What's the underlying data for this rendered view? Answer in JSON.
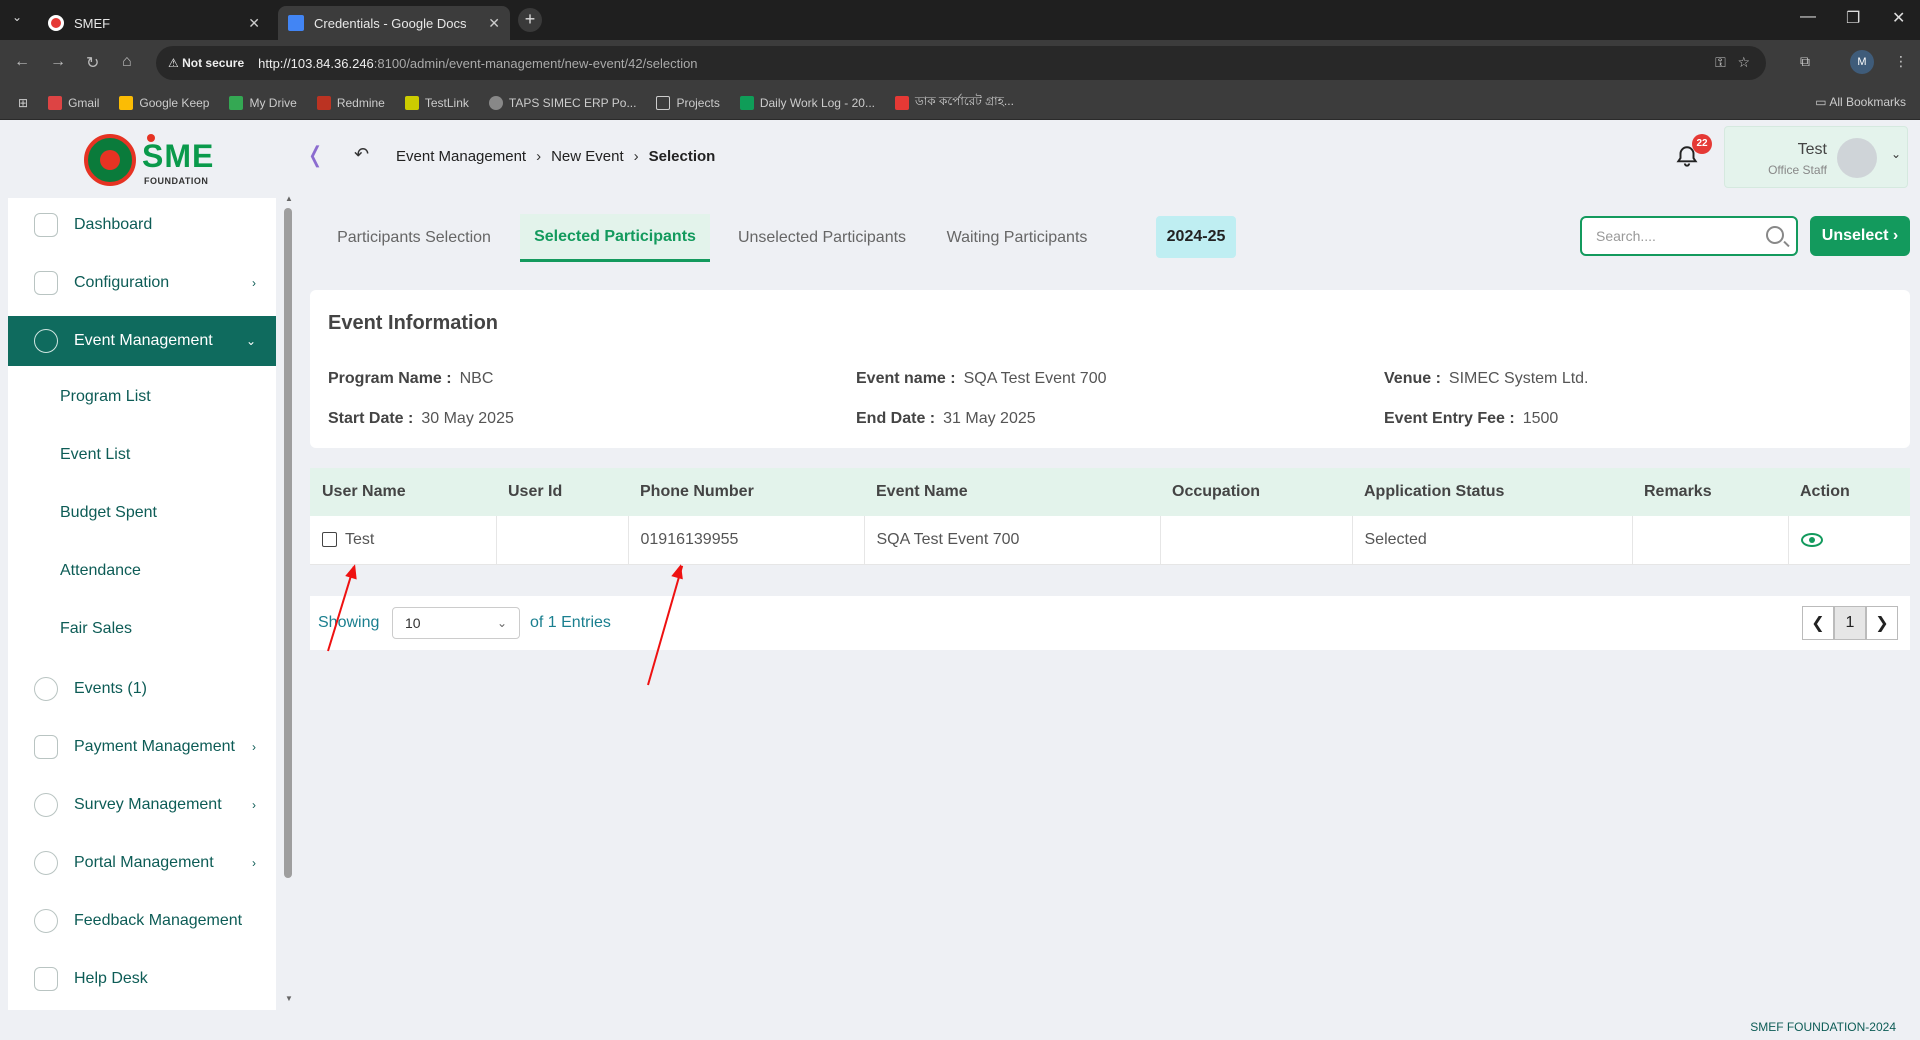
{
  "browser": {
    "tabs": [
      {
        "label": "SMEF"
      },
      {
        "label": "Credentials - Google Docs"
      }
    ],
    "security": "Not secure",
    "url_host": "http://103.84.36.246",
    "url_path": ":8100/admin/event-management/new-event/42/selection",
    "bookmarks": [
      "Gmail",
      "Google Keep",
      "My Drive",
      "Redmine",
      "TestLink",
      "TAPS SIMEC ERP Po...",
      "Projects",
      "Daily Work Log - 20...",
      "ডাক কর্পোরেট গ্রাহ..."
    ],
    "all_bookmarks": "All Bookmarks",
    "profile_initial": "M"
  },
  "header": {
    "logo_text": "SME",
    "logo_sub": "FOUNDATION",
    "breadcrumb": [
      "Event Management",
      "New Event",
      "Selection"
    ],
    "notification_count": "22",
    "user_name": "Test",
    "user_role": "Office Staff"
  },
  "sidebar": {
    "items": [
      {
        "label": "Dashboard"
      },
      {
        "label": "Configuration"
      },
      {
        "label": "Event Management"
      },
      {
        "label": "Events (1)"
      },
      {
        "label": "Payment Management"
      },
      {
        "label": "Survey Management"
      },
      {
        "label": "Portal Management"
      },
      {
        "label": "Feedback Management"
      },
      {
        "label": "Help Desk"
      }
    ],
    "subitems": [
      {
        "label": "Program List"
      },
      {
        "label": "Event List"
      },
      {
        "label": "Budget Spent"
      },
      {
        "label": "Attendance"
      },
      {
        "label": "Fair Sales"
      }
    ]
  },
  "tabs": [
    "Participants Selection",
    "Selected Participants",
    "Unselected Participants",
    "Waiting Participants"
  ],
  "year": "2024-25",
  "search": {
    "placeholder": "Search...."
  },
  "unselect_label": "Unselect ›",
  "event_info": {
    "title": "Event Information",
    "program_name_label": "Program Name :",
    "program_name": "NBC",
    "event_name_label": "Event name :",
    "event_name": "SQA Test Event 700",
    "venue_label": "Venue :",
    "venue": "SIMEC System Ltd.",
    "start_date_label": "Start Date :",
    "start_date": "30 May 2025",
    "end_date_label": "End Date :",
    "end_date": "31 May 2025",
    "fee_label": "Event Entry Fee :",
    "fee": "1500"
  },
  "table": {
    "headers": [
      "User Name",
      "User Id",
      "Phone Number",
      "Event Name",
      "Occupation",
      "Application Status",
      "Remarks",
      "Action"
    ],
    "rows": [
      {
        "user_name": "Test",
        "user_id": "",
        "phone": "01916139955",
        "event_name": "SQA Test Event 700",
        "occupation": "",
        "status": "Selected",
        "remarks": ""
      }
    ]
  },
  "pagination": {
    "showing": "Showing",
    "page_size": "10",
    "entries": "of 1 Entries",
    "current_page": "1"
  },
  "footer": "SMEF FOUNDATION-2024",
  "colors": {
    "brand_green": "#139a5d",
    "sidebar_active": "#0f6b5e",
    "annotation_red": "#ee1111"
  }
}
